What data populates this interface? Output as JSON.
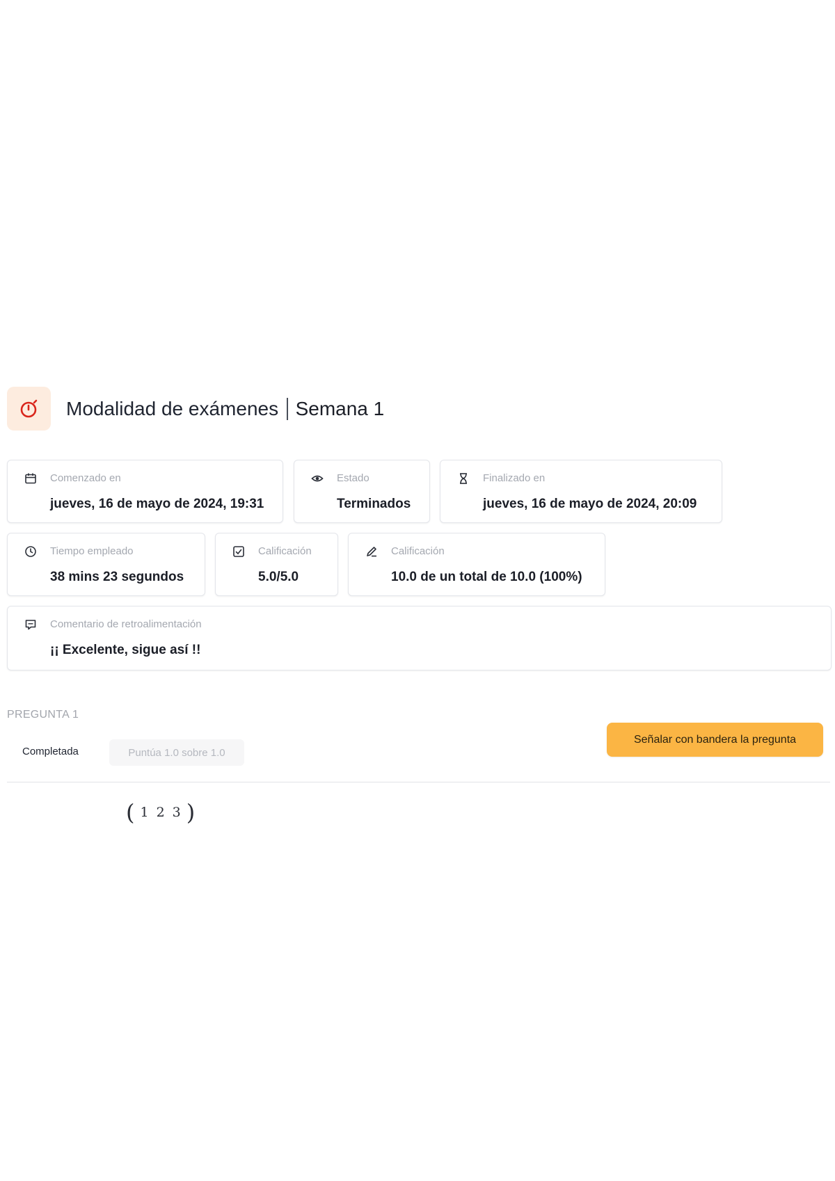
{
  "header": {
    "title": "Modalidad de exámenes",
    "subtitle": "Semana 1",
    "icon": "stopwatch-icon",
    "accent_color": "#d9261c"
  },
  "summary": {
    "started": {
      "label": "Comenzado en",
      "value": "jueves, 16 de mayo de 2024, 19:31",
      "icon": "calendar-icon"
    },
    "status": {
      "label": "Estado",
      "value": "Terminados",
      "icon": "eye-icon"
    },
    "finished": {
      "label": "Finalizado en",
      "value": "jueves, 16 de mayo de 2024, 20:09",
      "icon": "hourglass-icon"
    },
    "time_spent": {
      "label": "Tiempo empleado",
      "value": "38 mins 23 segundos",
      "icon": "clock-icon"
    },
    "grade_points": {
      "label": "Calificación",
      "value": "5.0/5.0",
      "icon": "checkbox-icon"
    },
    "grade_total": {
      "label": "Calificación",
      "value": "10.0 de un total de 10.0 (100%)",
      "icon": "pencil-icon"
    },
    "feedback": {
      "label": "Comentario de retroalimentación",
      "value": "¡¡ Excelente, sigue así !!",
      "icon": "comment-icon"
    }
  },
  "question": {
    "label": "PREGUNTA 1",
    "status": "Completada",
    "score": "Puntúa 1.0 sobre 1.0",
    "flag_button": "Señalar con bandera la pregunta",
    "flag_color": "#fbb544",
    "matrix": [
      "1",
      "2",
      "3"
    ]
  }
}
